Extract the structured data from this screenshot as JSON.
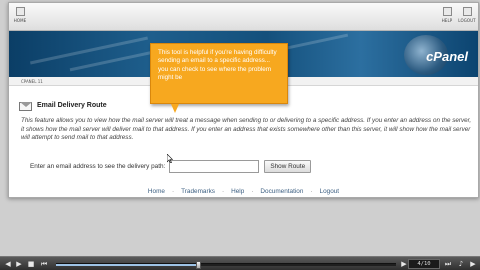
{
  "nav": {
    "home_label": "HOME",
    "help_label": "HELP",
    "logout_label": "LOGOUT"
  },
  "banner": {
    "logo_text": "cPanel"
  },
  "breadcrumb": "CPANEL 11",
  "page": {
    "heading": "Email Delivery Route",
    "description": "This feature allows you to view how the mail server will treat a message when sending to or delivering to a specific address. If you enter an address on the server, it shows how the mail server will deliver mail to that address. If you enter an address that exists somewhere other than this server, it will show how the mail server will attempt to send mail to that address.",
    "path_label": "Enter an email address to see the delivery path:",
    "path_value": "",
    "show_route_label": "Show Route"
  },
  "footer": {
    "links": [
      "Home",
      "Trademarks",
      "Help",
      "Documentation",
      "Logout"
    ]
  },
  "tooltip": {
    "text": "This tool is helpful if you're having difficulty sending an email to a specific address... you can check to see where the problem might be"
  },
  "player": {
    "progress": 0.42,
    "slide_counter": "4/10"
  },
  "colors": {
    "tooltip_bg": "#f7a81f",
    "banner_blue": "#1e5e8c",
    "footer_link": "#3c5f82"
  }
}
